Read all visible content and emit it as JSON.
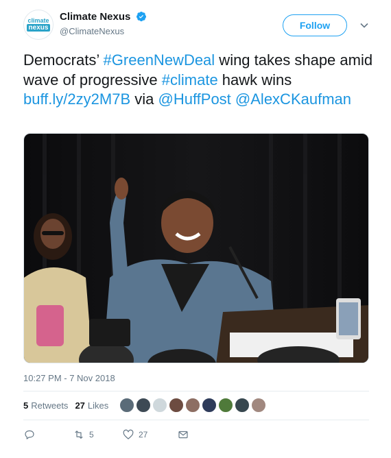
{
  "account": {
    "avatar_line1": "climate",
    "avatar_line2": "nexus",
    "display_name": "Climate Nexus",
    "handle": "@ClimateNexus",
    "verified": true
  },
  "follow_label": "Follow",
  "tweet": {
    "part1": "Democrats’ ",
    "hashtag1": "#GreenNewDeal",
    "part2": " wing takes shape amid wave of progressive ",
    "hashtag2": "#climate",
    "part3": " hawk wins ",
    "link": "buff.ly/2zy2M7B",
    "part4": " via ",
    "mention1": "@HuffPost",
    "mention2": "@AlexCKaufman"
  },
  "timestamp": "10:27 PM - 7 Nov 2018",
  "stats": {
    "retweets_count": "5",
    "retweets_label": "Retweets",
    "likes_count": "27",
    "likes_label": "Likes"
  },
  "liker_avatar_colors": [
    "#5a6b78",
    "#3d4a55",
    "#cfd8dc",
    "#6d4c41",
    "#8d6e63",
    "#2e3b5a",
    "#4f7a3a",
    "#37474f",
    "#a1887f"
  ],
  "actions": {
    "reply_count": "",
    "retweet_count": "5",
    "like_count": "27"
  },
  "colors": {
    "link": "#1b95e0",
    "follow": "#1da1f2",
    "brand": "#2aa3c8",
    "muted": "#657786"
  }
}
